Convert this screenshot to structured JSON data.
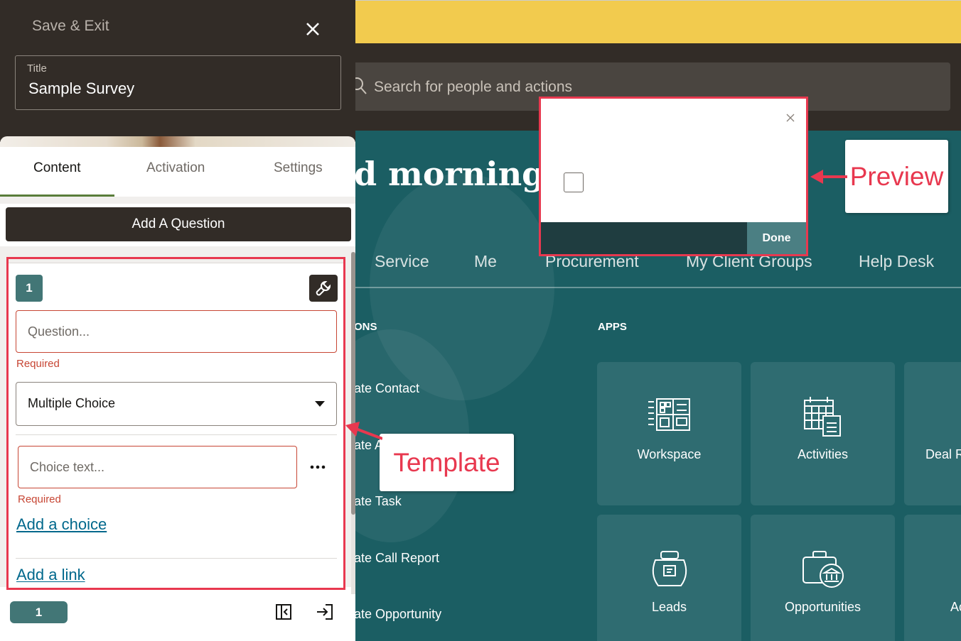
{
  "panel": {
    "save_exit_label": "Save & Exit",
    "title_label": "Title",
    "title_value": "Sample Survey",
    "tabs": [
      {
        "label": "Content",
        "active": true
      },
      {
        "label": "Activation",
        "active": false
      },
      {
        "label": "Settings",
        "active": false
      }
    ],
    "add_question_label": "Add A Question",
    "question": {
      "number": "1",
      "question_placeholder": "Question...",
      "question_required": "Required",
      "type_value": "Multiple Choice",
      "choice_placeholder": "Choice text...",
      "choice_required": "Required",
      "add_choice_label": "Add a choice",
      "add_link_label": "Add a link"
    },
    "footer": {
      "page_number": "1"
    }
  },
  "background": {
    "search_placeholder": "Search for people and actions",
    "greeting": "d morning, I",
    "nav_tabs": [
      "Service",
      "Me",
      "Procurement",
      "My Client Groups",
      "Help Desk"
    ],
    "quick_actions_label": "ONS",
    "apps_label": "APPS",
    "quick_actions": [
      "ate Contact",
      "ate A",
      "ate Task",
      "ate Call Report",
      "ate Opportunity"
    ],
    "apps": [
      "Workspace",
      "Activities",
      "Deal R",
      "Leads",
      "Opportunities",
      "Ac"
    ]
  },
  "preview": {
    "done_label": "Done"
  },
  "annotations": {
    "preview_label": "Preview",
    "template_label": "Template"
  },
  "colors": {
    "annotation_red": "#e8384f",
    "header_dark": "#322c27",
    "banner_yellow": "#f2cb4e",
    "teal_background": "#1b5e63",
    "accent_teal": "#427676",
    "error_red": "#c74634",
    "link_blue": "#00688c"
  }
}
